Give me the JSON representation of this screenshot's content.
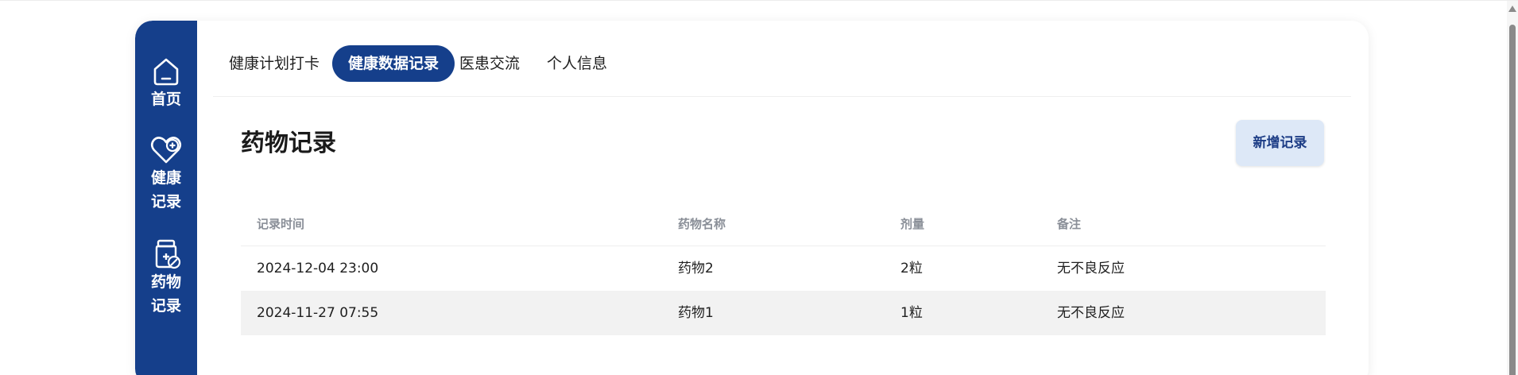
{
  "sidebar": {
    "items": [
      {
        "icon": "home-icon",
        "label": "首页"
      },
      {
        "icon": "heart-plus-icon",
        "label_lines": [
          "健康",
          "记录"
        ]
      },
      {
        "icon": "medicine-bottle-icon",
        "label_lines": [
          "药物",
          "记录"
        ]
      }
    ]
  },
  "topnav": {
    "tabs": [
      {
        "label": "健康计划打卡",
        "active": false
      },
      {
        "label": "健康数据记录",
        "active": true
      },
      {
        "label": "医患交流",
        "active": false
      },
      {
        "label": "个人信息",
        "active": false
      }
    ]
  },
  "section": {
    "title": "药物记录",
    "add_button_label": "新增记录"
  },
  "table": {
    "headers": [
      "记录时间",
      "药物名称",
      "剂量",
      "备注"
    ],
    "rows": [
      [
        "2024-12-04 23:00",
        "药物2",
        "2粒",
        "无不良反应"
      ],
      [
        "2024-11-27 07:55",
        "药物1",
        "1粒",
        "无不良反应"
      ]
    ]
  },
  "colors": {
    "brand": "#153f8b",
    "button_bg": "#dde8f7",
    "row_alt": "#f2f2f2"
  }
}
